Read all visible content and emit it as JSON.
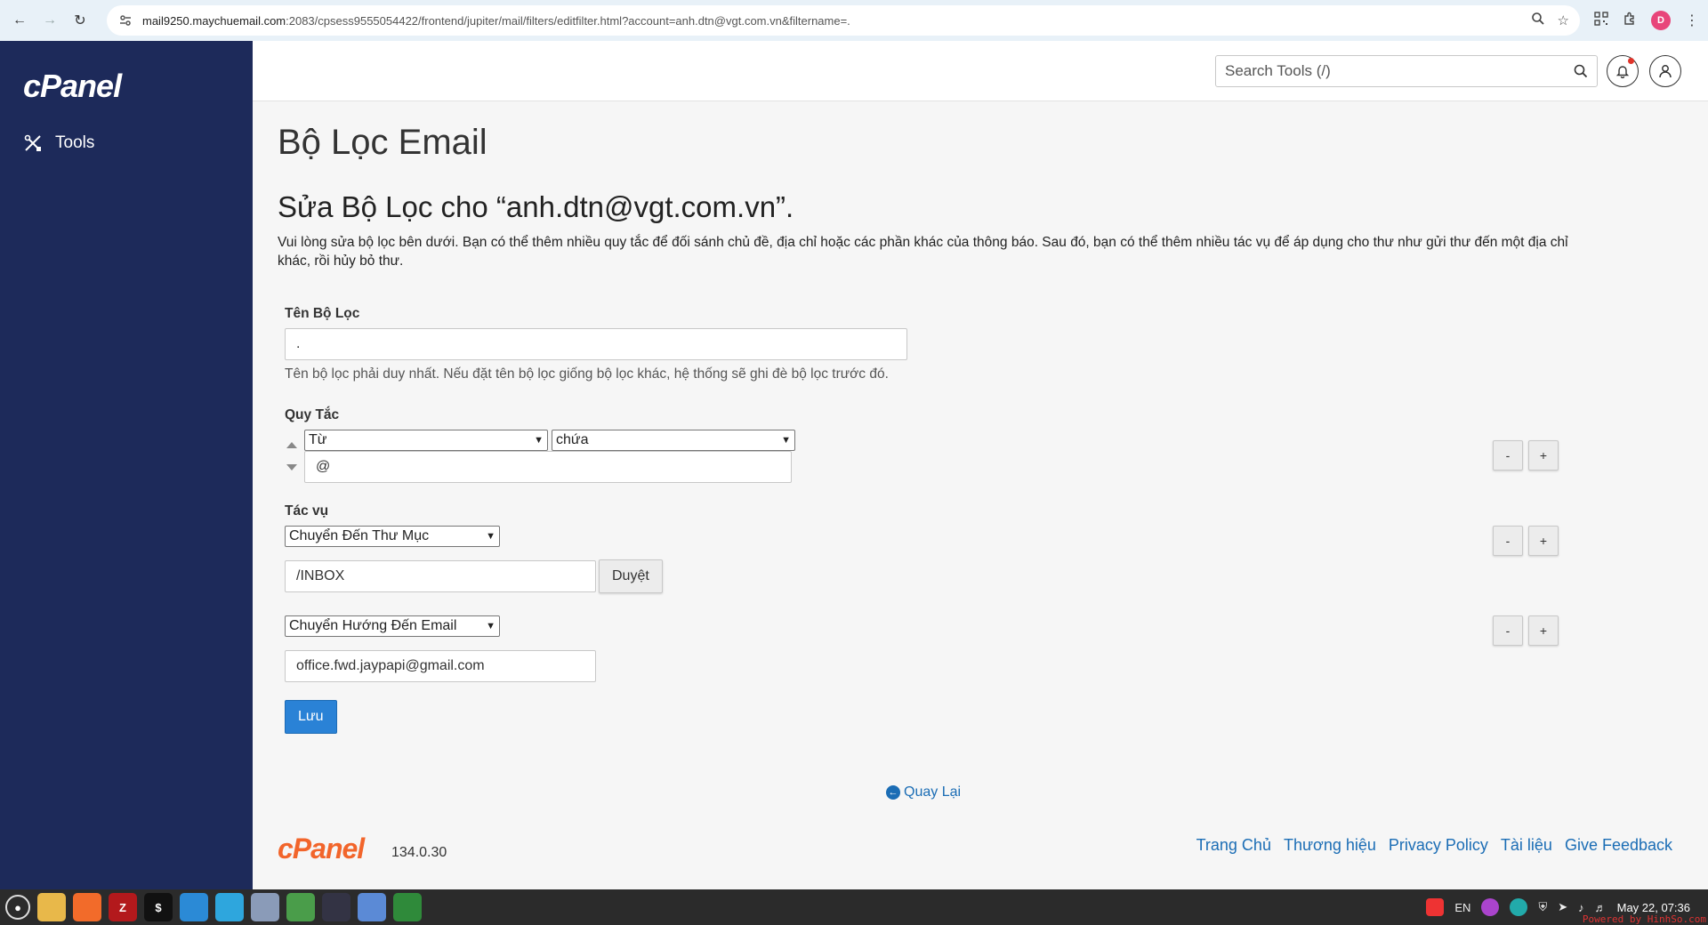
{
  "browser": {
    "url_host": "mail9250.maychuemail.com",
    "url_rest": ":2083/cpsess9555054422/frontend/jupiter/mail/filters/editfilter.html?account=anh.dtn@vgt.com.vn&filtername=.",
    "profile_initial": "D"
  },
  "sidebar": {
    "logo": "cPanel",
    "items": [
      {
        "label": "Tools"
      }
    ]
  },
  "header": {
    "search_placeholder": "Search Tools (/)"
  },
  "page": {
    "title": "Bộ Lọc Email",
    "subtitle": "Sửa Bộ Lọc cho “anh.dtn@vgt.com.vn”.",
    "description": "Vui lòng sửa bộ lọc bên dưới. Bạn có thể thêm nhiều quy tắc để đối sánh chủ đề, địa chỉ hoặc các phần khác của thông báo. Sau đó, bạn có thể thêm nhiều tác vụ để áp dụng cho thư như gửi thư đến một địa chỉ khác, rồi hủy bỏ thư."
  },
  "form": {
    "filter_name_label": "Tên Bộ Lọc",
    "filter_name_value": ".",
    "filter_name_help": "Tên bộ lọc phải duy nhất. Nếu đặt tên bộ lọc giống bộ lọc khác, hệ thống sẽ ghi đè bộ lọc trước đó.",
    "rules_label": "Quy Tắc",
    "rule_part": "Từ",
    "rule_match": "chứa",
    "rule_value": "@",
    "actions_label": "Tác vụ",
    "action1_type": "Chuyển Đến Thư Mục",
    "action1_value": "/INBOX",
    "browse_label": "Duyệt",
    "action2_type": "Chuyển Hướng Đến Email",
    "action2_value": "office.fwd.jaypapi@gmail.com",
    "minus_label": "-",
    "plus_label": "+",
    "save_label": "Lưu",
    "back_label": "Quay Lại"
  },
  "footer": {
    "logo": "cPanel",
    "version": "134.0.30",
    "links": [
      "Trang Chủ",
      "Thương hiệu",
      "Privacy Policy",
      "Tài liệu",
      "Give Feedback"
    ]
  },
  "taskbar": {
    "lang": "EN",
    "clock": "May 22, 07:36",
    "powered": "Powered by HinhSo.com"
  },
  "colors": {
    "sidebar": "#1d2a5a",
    "primary_button": "#2a82d6",
    "link": "#1b6db5",
    "brand_orange": "#f2652b"
  }
}
